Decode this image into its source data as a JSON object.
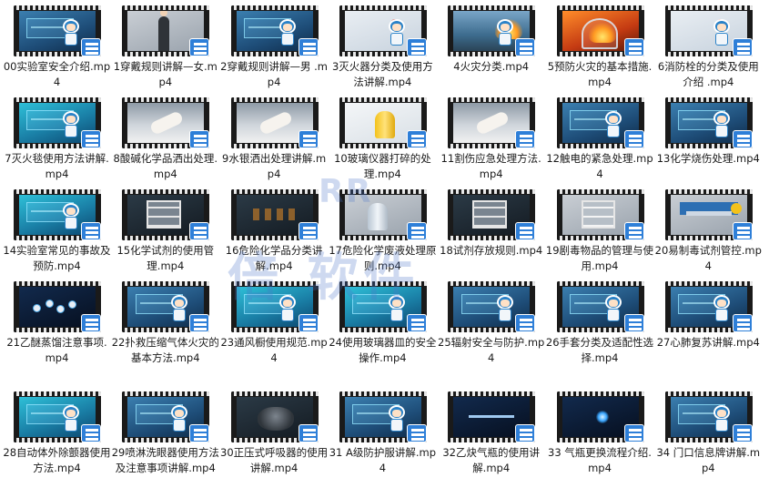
{
  "files": [
    {
      "name": "00实验室安全介绍.mp4",
      "thumb": "lab-mascot"
    },
    {
      "name": "1穿戴规则讲解—女.mp4",
      "thumb": "person-dark"
    },
    {
      "name": "2穿戴规则讲解—男 .mp4",
      "thumb": "lab-mascot"
    },
    {
      "name": "3灭火器分类及使用方法讲解.mp4",
      "thumb": "light-mascot"
    },
    {
      "name": "4火灾分类.mp4",
      "thumb": "city-mascot"
    },
    {
      "name": "5预防火灾的基本措施.mp4",
      "thumb": "fire-dome"
    },
    {
      "name": "6消防栓的分类及使用介绍 .mp4",
      "thumb": "light-mascot"
    },
    {
      "name": "7灭火毯使用方法讲解.mp4",
      "thumb": "teal-panel"
    },
    {
      "name": "8酸碱化学品洒出处理.mp4",
      "thumb": "table-hand"
    },
    {
      "name": "9水银洒出处理讲解.mp4",
      "thumb": "table-hand"
    },
    {
      "name": "10玻璃仪器打碎的处理.mp4",
      "thumb": "yellow-glass"
    },
    {
      "name": "11割伤应急处理方法.mp4",
      "thumb": "table-hand"
    },
    {
      "name": "12触电的紧急处理.mp4",
      "thumb": "lab-mascot"
    },
    {
      "name": "13化学烧伤处理.mp4",
      "thumb": "lab-mascot"
    },
    {
      "name": "14实验室常见的事故及预防.mp4",
      "thumb": "teal-panel"
    },
    {
      "name": "15化学试剂的使用管理.mp4",
      "thumb": "dark-shelf"
    },
    {
      "name": "16危险化学品分类讲解.mp4",
      "thumb": "dark-bottles"
    },
    {
      "name": "17危险化学废液处理原则.mp4",
      "thumb": "grey-cyl"
    },
    {
      "name": "18试剂存放规则.mp4",
      "thumb": "dark-shelf"
    },
    {
      "name": "19剧毒物品的管理与使用.mp4",
      "thumb": "grey-shelf"
    },
    {
      "name": "20易制毒试剂管控.mp4",
      "thumb": "banner"
    },
    {
      "name": "21乙醚蒸馏注意事项.mp4",
      "thumb": "molecule"
    },
    {
      "name": "22扑救压缩气体火灾的基本方法.mp4",
      "thumb": "lab-mascot"
    },
    {
      "name": "23通风橱使用规范.mp4",
      "thumb": "teal-panel"
    },
    {
      "name": "24使用玻璃器皿的安全操作.mp4",
      "thumb": "teal-panel"
    },
    {
      "name": "25辐射安全与防护.mp4",
      "thumb": "lab-mascot"
    },
    {
      "name": "26手套分类及适配性选择.mp4",
      "thumb": "lab-mascot"
    },
    {
      "name": "27心肺复苏讲解.mp4",
      "thumb": "lab-mascot"
    },
    {
      "name": "28自动体外除颤器使用方法.mp4",
      "thumb": "teal-panel"
    },
    {
      "name": "29喷淋洗眼器使用方法及注意事项讲解.mp4",
      "thumb": "lab-mascot"
    },
    {
      "name": "30正压式呼吸器的使用讲解.mp4",
      "thumb": "dark-mask"
    },
    {
      "name": "31 A级防护服讲解.mp4",
      "thumb": "lab-mascot"
    },
    {
      "name": "32乙炔气瓶的使用讲解.mp4",
      "thumb": "navy-caption"
    },
    {
      "name": "33 气瓶更换流程介绍.mp4",
      "thumb": "navy-spark"
    },
    {
      "name": "34 门口信息牌讲解.mp4",
      "thumb": "lab-mascot"
    }
  ],
  "watermark": {
    "logo": "RR",
    "brand": "倍  软件"
  },
  "colors": {
    "accent": "#2e7fd8",
    "text": "#1a1a1a",
    "watermark": "#5078c8"
  }
}
